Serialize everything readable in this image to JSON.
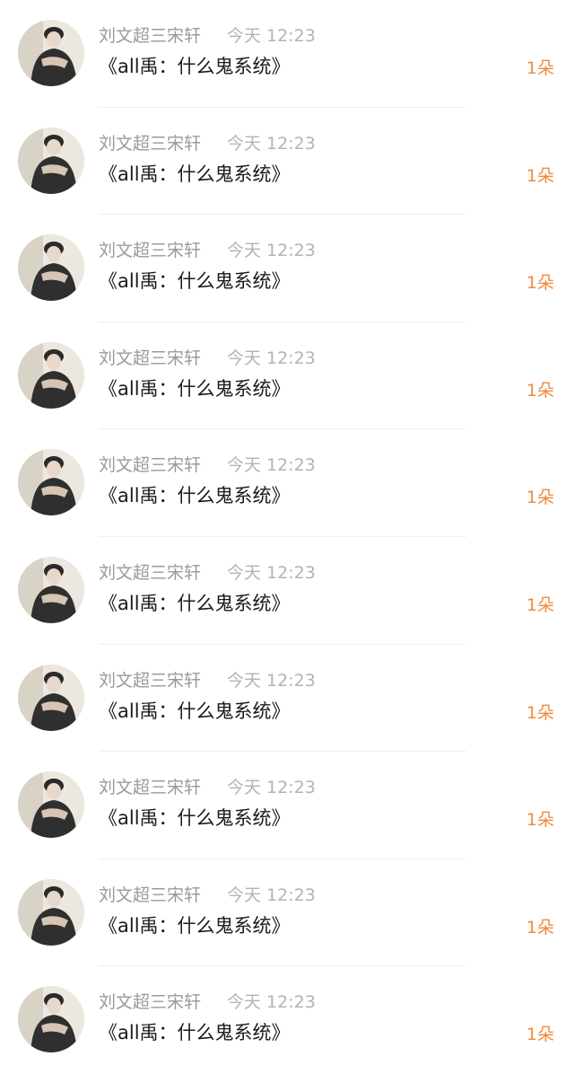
{
  "notifications": [
    {
      "user": "刘文超三宋轩",
      "time": "今天 12:23",
      "title": "《all禹：什么鬼系统》",
      "count": "1朵"
    },
    {
      "user": "刘文超三宋轩",
      "time": "今天 12:23",
      "title": "《all禹：什么鬼系统》",
      "count": "1朵"
    },
    {
      "user": "刘文超三宋轩",
      "time": "今天 12:23",
      "title": "《all禹：什么鬼系统》",
      "count": "1朵"
    },
    {
      "user": "刘文超三宋轩",
      "time": "今天 12:23",
      "title": "《all禹：什么鬼系统》",
      "count": "1朵"
    },
    {
      "user": "刘文超三宋轩",
      "time": "今天 12:23",
      "title": "《all禹：什么鬼系统》",
      "count": "1朵"
    },
    {
      "user": "刘文超三宋轩",
      "time": "今天 12:23",
      "title": "《all禹：什么鬼系统》",
      "count": "1朵"
    },
    {
      "user": "刘文超三宋轩",
      "time": "今天 12:23",
      "title": "《all禹：什么鬼系统》",
      "count": "1朵"
    },
    {
      "user": "刘文超三宋轩",
      "time": "今天 12:23",
      "title": "《all禹：什么鬼系统》",
      "count": "1朵"
    },
    {
      "user": "刘文超三宋轩",
      "time": "今天 12:23",
      "title": "《all禹：什么鬼系统》",
      "count": "1朵"
    },
    {
      "user": "刘文超三宋轩",
      "time": "今天 12:23",
      "title": "《all禹：什么鬼系统》",
      "count": "1朵"
    }
  ],
  "colors": {
    "background": "#ffffff",
    "username": "#9a9a9a",
    "timestamp": "#b3b3b3",
    "title": "#1a1a1a",
    "count_accent": "#f08a3c",
    "divider": "#efefef"
  },
  "icons": {
    "avatar": "user-avatar-photo"
  }
}
